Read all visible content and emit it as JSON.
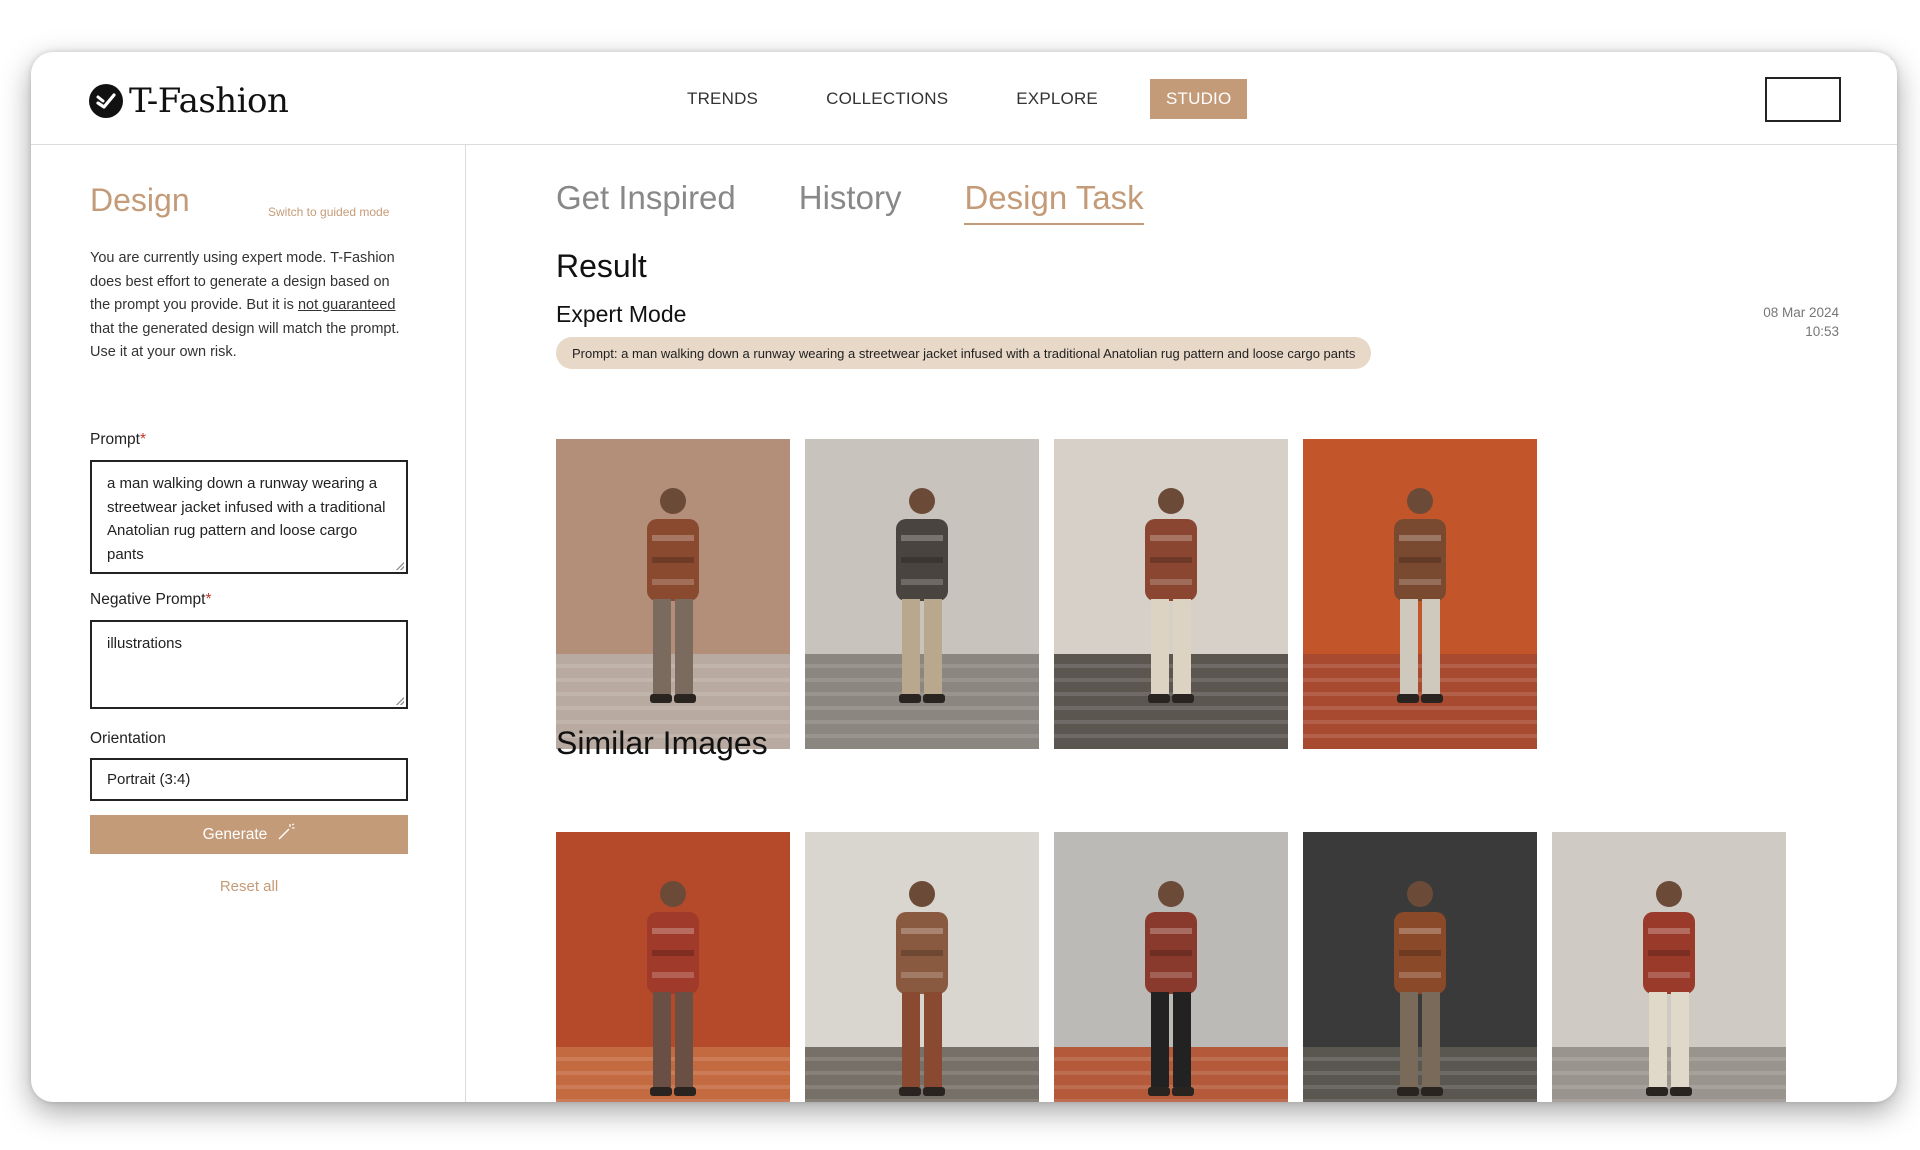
{
  "app": {
    "brand": "T-Fashion"
  },
  "nav": {
    "items": [
      "TRENDS",
      "COLLECTIONS",
      "EXPLORE",
      "STUDIO"
    ],
    "active": "STUDIO"
  },
  "sidebar": {
    "title": "Design",
    "switch_mode": "Switch to guided mode",
    "description_parts": {
      "p1": "You are currently using expert mode. T-Fashion does best effort to generate a design based on the prompt you provide. But it is ",
      "link1": "not guaranteed",
      "p2": " that the generated design will match the prompt. Use it at your own risk."
    },
    "prompt_label": "Prompt",
    "prompt_value": "a man walking down a runway wearing a streetwear jacket infused with a traditional Anatolian rug pattern and loose cargo pants",
    "negative_label": "Negative Prompt",
    "negative_value": "illustrations",
    "orientation_label": "Orientation",
    "orientation_value": "Portrait (3:4)",
    "required_mark": "*",
    "generate_label": "Generate",
    "reset_label": "Reset all"
  },
  "main": {
    "tabs": [
      "Get Inspired",
      "History",
      "Design Task"
    ],
    "active_tab": "Design Task",
    "result_title": "Result",
    "mode_title": "Expert Mode",
    "date": "08 Mar 2024",
    "time": "10:53",
    "prompt_pill": "Prompt: a man walking down a runway wearing a streetwear jacket infused with a traditional Anatolian rug pattern and loose cargo pants",
    "similar_title": "Similar Images"
  },
  "images": {
    "result": [
      {
        "bg": "#b38f7a",
        "floor": "#b8aaa0",
        "jacket": "#8a4a30",
        "pants": "#7b6a5e"
      },
      {
        "bg": "#c9c3bd",
        "floor": "#8c8680",
        "jacket": "#4a4440",
        "pants": "#b9a88e"
      },
      {
        "bg": "#d6d0c8",
        "floor": "#5c5650",
        "jacket": "#8a4630",
        "pants": "#ddd3c2"
      },
      {
        "bg": "#c2562a",
        "floor": "#a84a30",
        "jacket": "#7a4a30",
        "pants": "#cfc8bd"
      }
    ],
    "similar": [
      {
        "bg": "#b54a2a",
        "floor": "#c46a40",
        "jacket": "#a03a2a",
        "pants": "#6a5044"
      },
      {
        "bg": "#d9d5cf",
        "floor": "#777068",
        "jacket": "#8a5a40",
        "pants": "#8a4a32"
      },
      {
        "bg": "#bcbab6",
        "floor": "#b45a3a",
        "jacket": "#8a3a2c",
        "pants": "#222222"
      },
      {
        "bg": "#3a3a3a",
        "floor": "#5a5650",
        "jacket": "#8a4a2a",
        "pants": "#7a6a5a"
      },
      {
        "bg": "#cfcac4",
        "floor": "#9a948e",
        "jacket": "#9a3a2a",
        "pants": "#e0d8c8"
      }
    ]
  }
}
